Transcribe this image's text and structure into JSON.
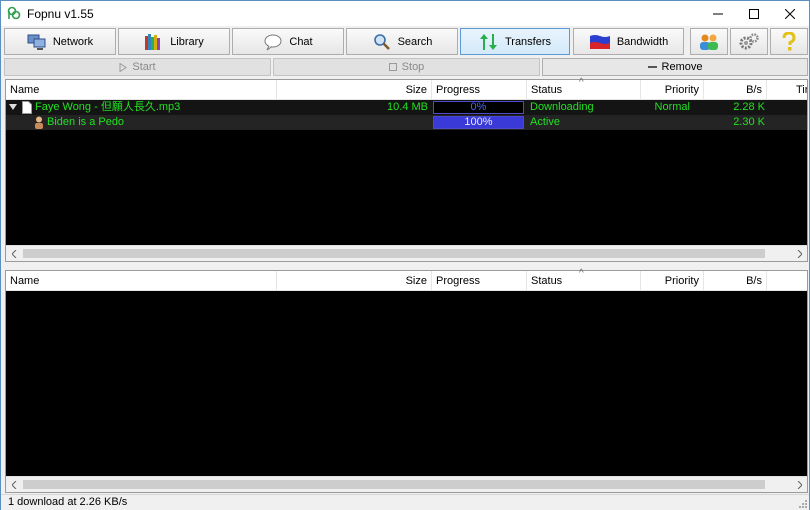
{
  "window": {
    "title": "Fopnu v1.55"
  },
  "toolbar": {
    "buttons": [
      {
        "id": "network",
        "label": "Network",
        "icon": "network-computer-icon"
      },
      {
        "id": "library",
        "label": "Library",
        "icon": "books-icon"
      },
      {
        "id": "chat",
        "label": "Chat",
        "icon": "speech-bubble-icon"
      },
      {
        "id": "search",
        "label": "Search",
        "icon": "magnifier-icon"
      },
      {
        "id": "transfers",
        "label": "Transfers",
        "icon": "up-down-arrows-icon",
        "active": true
      },
      {
        "id": "bandwidth",
        "label": "Bandwidth",
        "icon": "bandwidth-flag-icon"
      }
    ],
    "icon_buttons": [
      "users-icon",
      "gears-icon",
      "help-question-icon"
    ]
  },
  "actions": {
    "start": "Start",
    "stop": "Stop",
    "remove": "Remove"
  },
  "downloads": {
    "columns": [
      "Name",
      "Size",
      "Progress",
      "Status",
      "Priority",
      "B/s",
      "Tir"
    ],
    "rows": [
      {
        "name": "Faye Wong - 但願人長久.mp3",
        "size": "10.4 MB",
        "progress_text": "0%",
        "progress": 0.0,
        "status": "Downloading",
        "priority": "Normal",
        "rate": "2.28 K"
      },
      {
        "name": "Biden is a Pedo",
        "size": "",
        "progress_text": "100%",
        "progress": 1.0,
        "status": "Active",
        "priority": "",
        "rate": "2.30 K"
      }
    ]
  },
  "uploads": {
    "columns": [
      "Name",
      "Size",
      "Progress",
      "Status",
      "Priority",
      "B/s"
    ]
  },
  "statusbar": {
    "text": "1 download at 2.26 KB/s"
  },
  "colors": {
    "list_bg": "#000000",
    "list_text": "#22e022",
    "progress_fill": "#3a3ad8",
    "active_tab": "#d3e9fa"
  }
}
